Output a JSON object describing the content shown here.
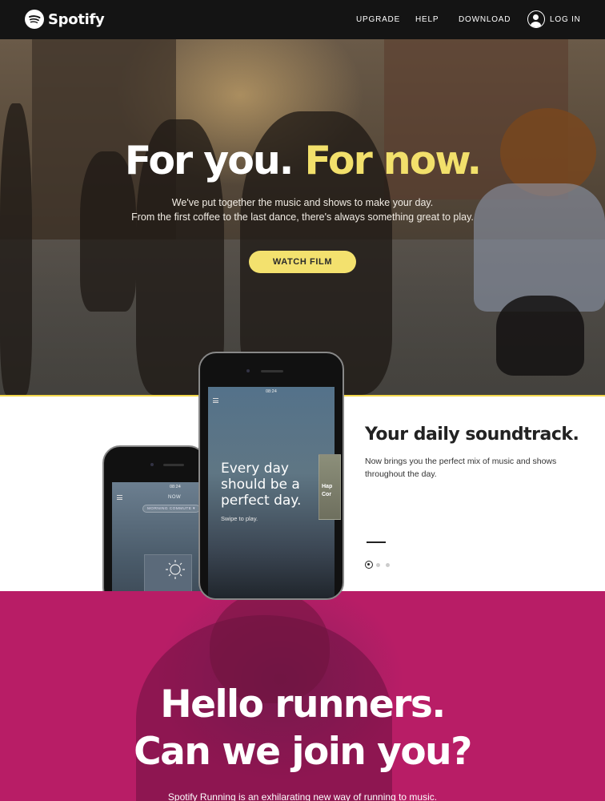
{
  "nav": {
    "brand": "Spotify",
    "links": [
      "UPGRADE",
      "HELP",
      "DOWNLOAD"
    ],
    "login": "LOG IN"
  },
  "hero": {
    "title_white": "For you.",
    "title_yellow": "For now.",
    "subtitle_line1": "We've put together the music and shows to make your day.",
    "subtitle_line2": "From the first coffee to the last dance, there's always something great to play.",
    "cta": "WATCH FILM"
  },
  "feature": {
    "title": "Your daily soundtrack.",
    "body": "Now brings you the perfect mix of music and shows throughout the day.",
    "phone_big": {
      "time": "08:24",
      "headline": "Every day should be a perfect day.",
      "swipe": "Swipe to play.",
      "card_line1": "Hap",
      "card_line2": "Cor"
    },
    "phone_small": {
      "time": "08:24",
      "now": "NOW",
      "chip": "MORNING COMMUTE"
    }
  },
  "running": {
    "title_line1": "Hello runners.",
    "title_line2": "Can we join you?",
    "subtitle": "Spotify Running is an exhilarating new way of running to music."
  },
  "colors": {
    "accent_yellow": "#f3e16e",
    "pink": "#bd1b67",
    "nav_bg": "#141414"
  }
}
